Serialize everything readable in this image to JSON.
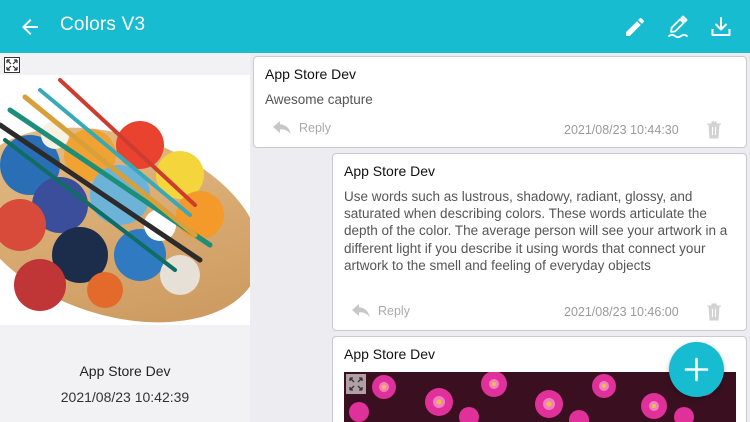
{
  "header": {
    "title": "Colors V3",
    "back_icon": "arrow-left-icon",
    "actions": [
      "pencil-icon",
      "edit-sign-icon",
      "download-icon"
    ]
  },
  "left": {
    "author": "App Store Dev",
    "timestamp": "2021/08/23 10:42:39"
  },
  "comments": [
    {
      "author": "App Store Dev",
      "text": "Awesome capture",
      "reply_label": "Reply",
      "timestamp": "2021/08/23 10:44:30"
    },
    {
      "author": "App Store Dev",
      "text": "Use words such as lustrous, shadowy, radiant, glossy, and saturated when describing colors. These words articulate the depth of the color. The average person will see your artwork in a different light if you describe it using words that connect your artwork to the smell and feeling of everyday objects",
      "reply_label": "Reply",
      "timestamp": "2021/08/23 10:46:00"
    },
    {
      "author": "App Store Dev"
    }
  ],
  "colors": {
    "accent": "#17bcd1",
    "card_border": "#c9c9cf",
    "muted": "#9a9a9a"
  }
}
